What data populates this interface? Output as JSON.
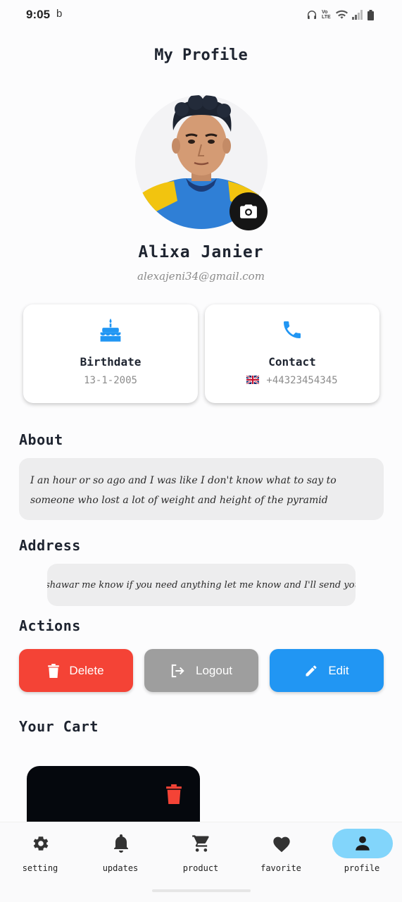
{
  "status_bar": {
    "time": "9:05",
    "extra": "b",
    "icons": [
      "headphones-icon",
      "volte-icon",
      "wifi-icon",
      "signal-icon",
      "battery-icon"
    ],
    "network": "Vo LTE"
  },
  "header": {
    "title": "My Profile"
  },
  "profile": {
    "name": "Alixa Janier",
    "email": "alexajeni34@gmail.com",
    "avatar_alt": "profile-photo"
  },
  "cards": {
    "birthdate": {
      "title": "Birthdate",
      "value": "13-1-2005",
      "icon": "cake-icon"
    },
    "contact": {
      "title": "Contact",
      "value": "+44323454345",
      "icon": "phone-icon",
      "flag": "uk-flag"
    }
  },
  "about": {
    "title": "About",
    "text": "I an hour or so ago and I was like I don't know what to say to someone who lost a lot of weight and height of the pyramid"
  },
  "address": {
    "title": "Address",
    "text": "Peshawar me know if you need anything let me know and I'll send you a"
  },
  "actions": {
    "title": "Actions",
    "delete_label": "Delete",
    "logout_label": "Logout",
    "edit_label": "Edit"
  },
  "cart": {
    "title": "Your Cart"
  },
  "bottom_nav": {
    "items": [
      {
        "label": "setting",
        "icon": "gear-icon"
      },
      {
        "label": "updates",
        "icon": "bell-icon"
      },
      {
        "label": "product",
        "icon": "cart-icon"
      },
      {
        "label": "favorite",
        "icon": "heart-icon"
      },
      {
        "label": "profile",
        "icon": "person-icon",
        "active": true
      }
    ]
  },
  "colors": {
    "delete": "#f44336",
    "logout": "#9e9e9e",
    "edit": "#2196f3",
    "accent_blue": "#2196f3",
    "nav_active": "#82d5fb"
  }
}
